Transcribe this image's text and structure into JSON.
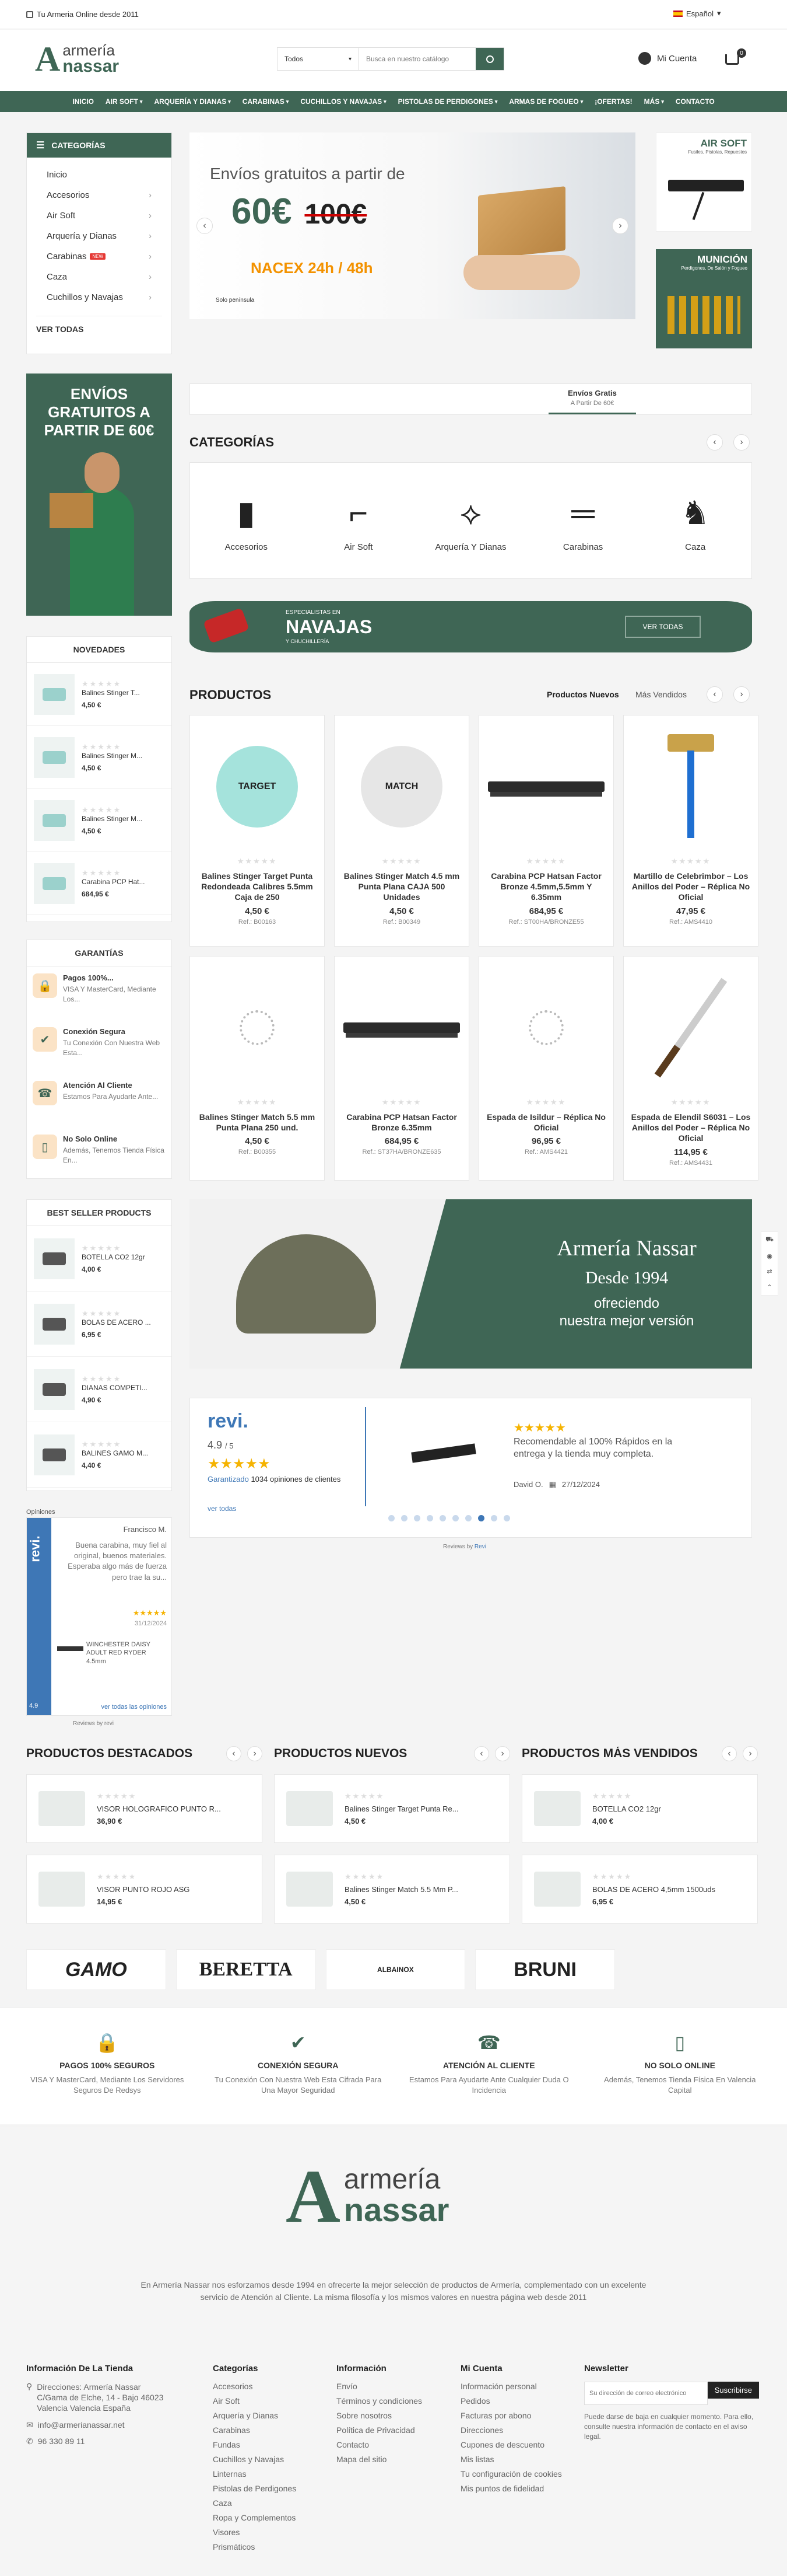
{
  "topbar": {
    "tagline": "Tu Armeria Online desde 2011",
    "language": "Español"
  },
  "header": {
    "logo_top": "armería",
    "logo_bottom": "nassar",
    "search_category": "Todos",
    "search_placeholder": "Busca en nuestro catálogo",
    "account_label": "Mi Cuenta",
    "cart_count": "0"
  },
  "nav": [
    "INICIO",
    "AIR SOFT",
    "ARQUERÍA Y DIANAS",
    "CARABINAS",
    "CUCHILLOS Y NAVAJAS",
    "PISTOLAS DE PERDIGONES",
    "ARMAS DE FOGUEO",
    "¡OFERTAS!",
    "MÁS",
    "CONTACTO"
  ],
  "sidebar_categories": {
    "title": "CATEGORÍAS",
    "items": [
      {
        "label": "Inicio",
        "arrow": false
      },
      {
        "label": "Accesorios",
        "arrow": true
      },
      {
        "label": "Air Soft",
        "arrow": true
      },
      {
        "label": "Arquería y Dianas",
        "arrow": true
      },
      {
        "label": "Carabinas",
        "arrow": true,
        "badge": "NEW"
      },
      {
        "label": "Caza",
        "arrow": true
      },
      {
        "label": "Cuchillos y Navajas",
        "arrow": true
      }
    ],
    "view_all": "VER TODAS"
  },
  "hero": {
    "line1": "Envíos gratuitos a partir de",
    "price": "60€",
    "old_price": "100€",
    "carrier": "NACEX 24h / 48h",
    "note": "Solo península"
  },
  "side_banners": [
    {
      "title": "AIR SOFT",
      "subtitle": "Fusiles, Pistolas, Repuestos"
    },
    {
      "title": "MUNICIÓN",
      "subtitle": "Perdigones, De Salón y Fogueo"
    }
  ],
  "shipping_strip": {
    "title": "Envíos Gratis",
    "sub": "A Partir De 60€"
  },
  "left_promo": {
    "text": "ENVÍOS GRATUITOS A PARTIR DE 60€"
  },
  "categories": {
    "title": "CATEGORÍAS",
    "items": [
      "Accesorios",
      "Air Soft",
      "Arquería Y Dianas",
      "Carabinas",
      "Caza"
    ]
  },
  "knife_banner": {
    "small": "ESPECIALISTAS EN",
    "big": "NAVAJAS",
    "sub": "Y CHUCHILLERÍA",
    "button": "VER TODAS"
  },
  "novedades": {
    "title": "NOVEDADES",
    "items": [
      {
        "name": "Balines Stinger T...",
        "price": "4,50 €"
      },
      {
        "name": "Balines Stinger M...",
        "price": "4,50 €"
      },
      {
        "name": "Balines Stinger M...",
        "price": "4,50 €"
      },
      {
        "name": "Carabina PCP Hat...",
        "price": "684,95 €"
      }
    ]
  },
  "garantias": {
    "title": "GARANTÍAS",
    "items": [
      {
        "title": "Pagos 100%...",
        "desc": "VISA Y MasterCard, Mediante Los..."
      },
      {
        "title": "Conexión Segura",
        "desc": "Tu Conexión Con Nuestra Web Esta..."
      },
      {
        "title": "Atención Al Cliente",
        "desc": "Estamos Para Ayudarte Ante..."
      },
      {
        "title": "No Solo Online",
        "desc": "Además, Tenemos Tienda Física En..."
      }
    ]
  },
  "bestseller": {
    "title": "BEST SELLER PRODUCTS",
    "items": [
      {
        "name": "BOTELLA CO2 12gr",
        "price": "4,00 €"
      },
      {
        "name": "BOLAS DE ACERO ...",
        "price": "6,95 €"
      },
      {
        "name": "DIANAS COMPETI...",
        "price": "4,90 €"
      },
      {
        "name": "BALINES GAMO M...",
        "price": "4,40 €"
      }
    ]
  },
  "products": {
    "title": "PRODUCTOS",
    "tab_new": "Productos Nuevos",
    "tab_sold": "Más Vendidos",
    "items": [
      {
        "name": "Balines Stinger Target Punta Redondeada Calibres 5.5mm Caja de 250",
        "price": "4,50 €",
        "ref": "Ref.: B00163",
        "img": "target"
      },
      {
        "name": "Balines Stinger Match 4.5 mm Punta Plana CAJA 500 Unidades",
        "price": "4,50 €",
        "ref": "Ref.: B00349",
        "img": "match"
      },
      {
        "name": "Carabina PCP Hatsan Factor Bronze 4.5mm,5.5mm Y 6.35mm",
        "price": "684,95 €",
        "ref": "Ref.: ST00HA/BRONZE55",
        "img": "rifle"
      },
      {
        "name": "Martillo de Celebrimbor – Los Anillos del Poder – Réplica No Oficial",
        "price": "47,95 €",
        "ref": "Ref.: AMS4410",
        "img": "hammer"
      },
      {
        "name": "Balines Stinger Match 5.5 mm Punta Plana 250 und.",
        "price": "4,50 €",
        "ref": "Ref.: B00355",
        "img": "loading"
      },
      {
        "name": "Carabina PCP Hatsan Factor Bronze 6.35mm",
        "price": "684,95 €",
        "ref": "Ref.: ST37HA/BRONZE635",
        "img": "rifle"
      },
      {
        "name": "Espada de Isildur – Réplica No Oficial",
        "price": "96,95 €",
        "ref": "Ref.: AMS4421",
        "img": "loading"
      },
      {
        "name": "Espada de Elendil S6031 – Los Anillos del Poder – Réplica No Oficial",
        "price": "114,95 €",
        "ref": "Ref.: AMS4431",
        "img": "sword"
      }
    ]
  },
  "nassar_banner": {
    "title": "Armería Nassar",
    "since": "Desde 1994",
    "line2": "ofreciendo",
    "line3": "nuestra mejor versión"
  },
  "revi": {
    "logo": "revi.",
    "score": "4.9",
    "out_of": "/ 5",
    "guaranteed": "Garantizado",
    "count": "1034 opiniones de clientes",
    "see_all": "ver todas",
    "review_text": "Recomendable al 100% Rápidos en la entrega y la tienda muy completa.",
    "author": "David O.",
    "date": "27/12/2024",
    "powered": "Reviews by",
    "powered_brand": "Revi"
  },
  "side_revi": {
    "label": "Opiniones",
    "author": "Francisco M.",
    "text": "Buena carabina, muy fiel al original, buenos materiales. Esperaba algo más de fuerza pero trae la su...",
    "date": "31/12/2024",
    "product": "WINCHESTER DAISY ADULT RED RYDER 4.5mm",
    "score": "4.9",
    "link": "ver todas las opiniones",
    "powered": "Reviews by revi"
  },
  "bottom_lists": [
    {
      "title": "PRODUCTOS DESTACADOS",
      "items": [
        {
          "name": "VISOR HOLOGRAFICO PUNTO R...",
          "price": "36,90 €"
        },
        {
          "name": "VISOR PUNTO ROJO ASG",
          "price": "14,95 €"
        }
      ]
    },
    {
      "title": "PRODUCTOS NUEVOS",
      "items": [
        {
          "name": "Balines Stinger Target Punta Re...",
          "price": "4,50 €"
        },
        {
          "name": "Balines Stinger Match 5.5 Mm P...",
          "price": "4,50 €"
        }
      ]
    },
    {
      "title": "PRODUCTOS MÁS VENDIDOS",
      "items": [
        {
          "name": "BOTELLA CO2 12gr",
          "price": "4,00 €"
        },
        {
          "name": "BOLAS DE ACERO 4,5mm 1500uds",
          "price": "6,95 €"
        }
      ]
    }
  ],
  "brands": [
    "GAMO",
    "BERETTA",
    "ALBAINOX",
    "BRUNI"
  ],
  "features": [
    {
      "title": "PAGOS 100% SEGUROS",
      "desc": "VISA Y MasterCard, Mediante Los Servidores Seguros De Redsys"
    },
    {
      "title": "CONEXIÓN SEGURA",
      "desc": "Tu Conexión Con Nuestra Web Esta Cifrada Para Una Mayor Seguridad"
    },
    {
      "title": "ATENCIÓN AL CLIENTE",
      "desc": "Estamos Para Ayudarte Ante Cualquier Duda O Incidencia"
    },
    {
      "title": "NO SOLO ONLINE",
      "desc": "Además, Tenemos Tienda Física En Valencia Capital"
    }
  ],
  "footer": {
    "about": "En Armería Nassar nos esforzamos desde 1994 en ofrecerte la mejor selección de productos de Armería, complementado con un excelente servicio de Atención al Cliente. La misma filosofía y los mismos valores en nuestra página web desde 2011",
    "info_title": "Información De La Tienda",
    "address": "Direcciones: Armería Nassar C/Gama de Elche, 14 - Bajo 46023 Valencia Valencia España",
    "email": "info@armerianassar.net",
    "phone": "96 330 89 11",
    "cats_title": "Categorías",
    "cats": [
      "Accesorios",
      "Air Soft",
      "Arquería y Dianas",
      "Carabinas",
      "Fundas",
      "Cuchillos y Navajas",
      "Linternas",
      "Pistolas de Perdigones",
      "Caza",
      "Ropa y Complementos",
      "Visores",
      "Prismáticos"
    ],
    "inf_title": "Información",
    "inf": [
      "Envío",
      "Términos y condiciones",
      "Sobre nosotros",
      "Política de Privacidad",
      "Contacto",
      "Mapa del sitio"
    ],
    "acc_title": "Mi Cuenta",
    "acc": [
      "Información personal",
      "Pedidos",
      "Facturas por abono",
      "Direcciones",
      "Cupones de descuento",
      "Mis listas",
      "Tu configuración de cookies",
      "Mis puntos de fidelidad"
    ],
    "news_title": "Newsletter",
    "news_placeholder": "Su dirección de correo electrónico",
    "news_button": "Suscribirse",
    "news_note": "Puede darse de baja en cualquier momento. Para ello, consulte nuestra información de contacto en el aviso legal."
  }
}
